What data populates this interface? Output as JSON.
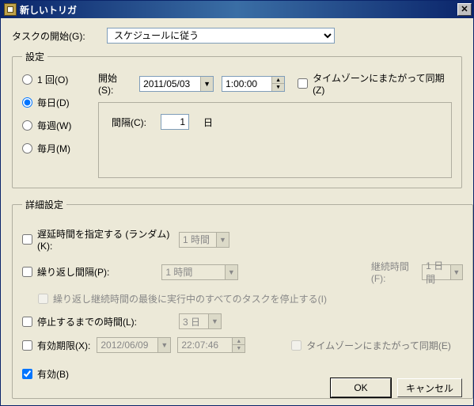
{
  "title": "新しいトリガ",
  "task_begin_label": "タスクの開始(G):",
  "task_begin_value": "スケジュールに従う",
  "settings": {
    "legend": "設定",
    "radios": {
      "once": "1 回(O)",
      "daily": "毎日(D)",
      "weekly": "毎週(W)",
      "monthly": "毎月(M)"
    },
    "selected": "daily",
    "start_label": "開始(S):",
    "start_date": "2011/05/03",
    "start_time": "1:00:00",
    "tz_sync_label": "タイムゾーンにまたがって同期(Z)",
    "interval_label": "間隔(C):",
    "interval_value": "1",
    "interval_unit": "日"
  },
  "advanced": {
    "legend": "詳細設定",
    "random_delay_label": "遅延時間を指定する (ランダム)(K):",
    "random_delay_value": "1 時間",
    "repeat_interval_label": "繰り返し間隔(P):",
    "repeat_interval_value": "1 時間",
    "duration_label": "継続時間(F):",
    "duration_value": "1 日間",
    "stop_all_label": "繰り返し継続時間の最後に実行中のすべてのタスクを停止する(I)",
    "stop_after_label": "停止するまでの時間(L):",
    "stop_after_value": "3 日",
    "expire_label": "有効期限(X):",
    "expire_date": "2012/06/09",
    "expire_time": "22:07:46",
    "expire_tz_label": "タイムゾーンにまたがって同期(E)",
    "enabled_label": "有効(B)"
  },
  "buttons": {
    "ok": "OK",
    "cancel": "キャンセル"
  }
}
